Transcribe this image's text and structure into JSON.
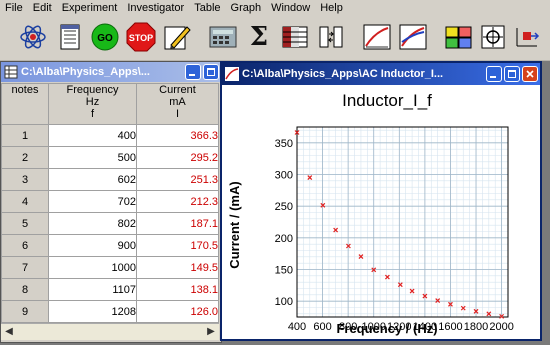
{
  "menu": [
    "File",
    "Edit",
    "Experiment",
    "Investigator",
    "Table",
    "Graph",
    "Window",
    "Help"
  ],
  "toolbar": {
    "go_label": "GO",
    "stop_label": "STOP",
    "sigma": "Σ"
  },
  "table_window": {
    "title": "C:\\Alba\\Physics_Apps\\...",
    "columns": [
      {
        "name": "notes"
      },
      {
        "name": "Frequency",
        "unit": "Hz",
        "symbol": "f"
      },
      {
        "name": "Current",
        "unit": "mA",
        "symbol": "I"
      }
    ],
    "rows": [
      {
        "n": "1",
        "f": "400",
        "c": "366.3"
      },
      {
        "n": "2",
        "f": "500",
        "c": "295.2"
      },
      {
        "n": "3",
        "f": "602",
        "c": "251.3"
      },
      {
        "n": "4",
        "f": "702",
        "c": "212.3"
      },
      {
        "n": "5",
        "f": "802",
        "c": "187.1"
      },
      {
        "n": "6",
        "f": "900",
        "c": "170.5"
      },
      {
        "n": "7",
        "f": "1000",
        "c": "149.5"
      },
      {
        "n": "8",
        "f": "1107",
        "c": "138.1"
      },
      {
        "n": "9",
        "f": "1208",
        "c": "126.0"
      }
    ]
  },
  "graph_window": {
    "title": "C:\\Alba\\Physics_Apps\\AC Inductor_I..."
  },
  "chart_data": {
    "type": "scatter",
    "title": "Inductor_I_f",
    "xlabel": "Frequency / (Hz)",
    "ylabel": "Current / (mA)",
    "xlim": [
      400,
      2050
    ],
    "ylim": [
      75,
      375
    ],
    "x_ticks": [
      "400",
      "600",
      "800",
      "1000",
      "1200",
      "1400",
      "1600",
      "1800",
      "2000"
    ],
    "y_ticks": [
      "100",
      "150",
      "200",
      "250",
      "300",
      "350"
    ],
    "grid": true,
    "marker_color": "#e02020",
    "series": [
      {
        "x": [
          400,
          500,
          602,
          702,
          802,
          900,
          1000,
          1107,
          1208,
          1300,
          1400,
          1500,
          1600,
          1700,
          1800,
          1900,
          2000
        ],
        "y": [
          366.3,
          295.2,
          251.3,
          212.3,
          187.1,
          170.5,
          149.5,
          138.1,
          126.0,
          116,
          108,
          101,
          95,
          89,
          84,
          80,
          76
        ]
      }
    ]
  }
}
